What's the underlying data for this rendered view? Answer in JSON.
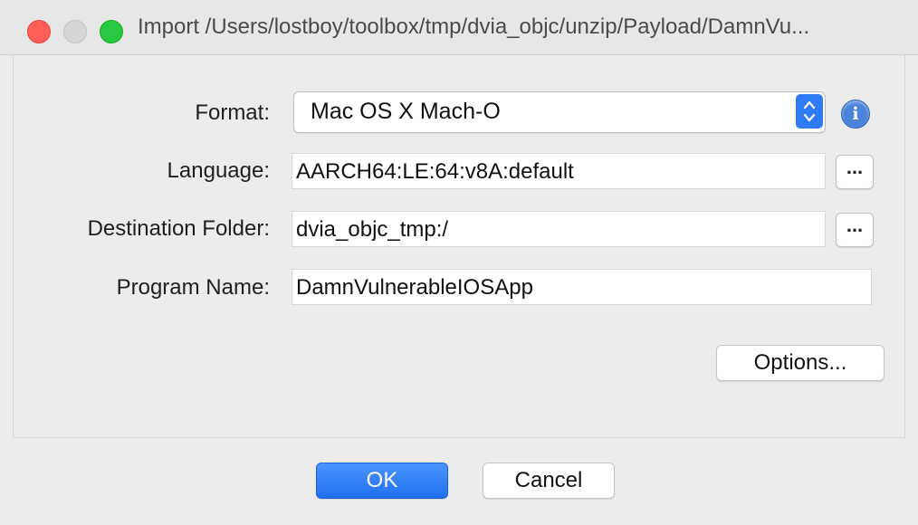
{
  "window": {
    "title": "Import /Users/lostboy/toolbox/tmp/dvia_objc/unzip/Payload/DamnVu..."
  },
  "form": {
    "format_label": "Format:",
    "format_value": "Mac OS X Mach-O",
    "language_label": "Language:",
    "language_value": "AARCH64:LE:64:v8A:default",
    "destination_label": "Destination Folder:",
    "destination_value": "dvia_objc_tmp:/",
    "program_label": "Program Name:",
    "program_value": "DamnVulnerableIOSApp",
    "browse_label": "...",
    "options_label": "Options..."
  },
  "buttons": {
    "ok": "OK",
    "cancel": "Cancel"
  },
  "icons": {
    "info": "i"
  },
  "colors": {
    "primary": "#2f7bf5",
    "close": "#ff5f57",
    "maximize": "#28c840"
  }
}
